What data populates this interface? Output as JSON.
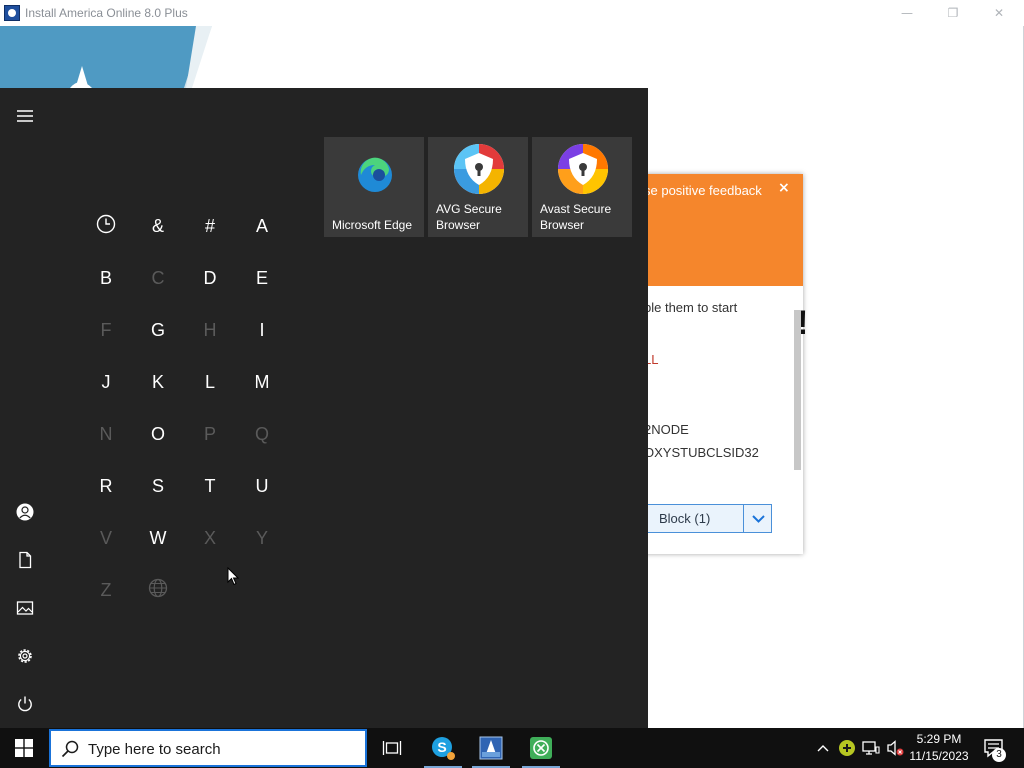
{
  "installer": {
    "title": "Install America Online 8.0 Plus",
    "minimize": "—",
    "maximize": "❐",
    "close": "✕"
  },
  "notification": {
    "header_text": "se positive feedback",
    "close": "×",
    "body_text": "ble them to start",
    "bang": "!",
    "red_text": "LL",
    "code_line_1": "2NODE",
    "code_line_2": "OXYSTUBCLSID32",
    "block_button": "Block (1)"
  },
  "start_menu": {
    "letters": [
      {
        "label": "",
        "icon": "recent-icon",
        "enabled": true
      },
      {
        "label": "&",
        "enabled": true
      },
      {
        "label": "#",
        "enabled": true
      },
      {
        "label": "A",
        "enabled": true
      },
      {
        "label": "B",
        "enabled": true
      },
      {
        "label": "C",
        "enabled": false
      },
      {
        "label": "D",
        "enabled": true
      },
      {
        "label": "E",
        "enabled": true
      },
      {
        "label": "F",
        "enabled": false
      },
      {
        "label": "G",
        "enabled": true
      },
      {
        "label": "H",
        "enabled": false
      },
      {
        "label": "I",
        "enabled": true
      },
      {
        "label": "J",
        "enabled": true
      },
      {
        "label": "K",
        "enabled": true
      },
      {
        "label": "L",
        "enabled": true
      },
      {
        "label": "M",
        "enabled": true
      },
      {
        "label": "N",
        "enabled": false
      },
      {
        "label": "O",
        "enabled": true
      },
      {
        "label": "P",
        "enabled": false
      },
      {
        "label": "Q",
        "enabled": false
      },
      {
        "label": "R",
        "enabled": true
      },
      {
        "label": "S",
        "enabled": true
      },
      {
        "label": "T",
        "enabled": true
      },
      {
        "label": "U",
        "enabled": true
      },
      {
        "label": "V",
        "enabled": false
      },
      {
        "label": "W",
        "enabled": true
      },
      {
        "label": "X",
        "enabled": false
      },
      {
        "label": "Y",
        "enabled": false
      },
      {
        "label": "Z",
        "enabled": false
      },
      {
        "label": "",
        "icon": "globe-icon",
        "enabled": false
      }
    ],
    "tiles": [
      {
        "label": "Microsoft Edge",
        "icon": "edge-icon"
      },
      {
        "label": "AVG Secure Browser",
        "icon": "avg-browser-icon"
      },
      {
        "label": "Avast Secure Browser",
        "icon": "avast-browser-icon"
      }
    ],
    "rail": [
      "menu-icon",
      "user-icon",
      "documents-icon",
      "pictures-icon",
      "settings-icon",
      "power-icon"
    ]
  },
  "taskbar": {
    "search_placeholder": "Type here to search",
    "time": "5:29 PM",
    "date": "11/15/2023",
    "notification_count": "3",
    "apps": [
      "task-view-icon",
      "skype-icon",
      "aol-installer-icon",
      "spreadsheet-app-icon"
    ]
  },
  "colors": {
    "start_bg": "#232323",
    "taskbar_bg": "#101010",
    "notification_accent": "#f5862c",
    "search_border": "#1a73d9"
  }
}
